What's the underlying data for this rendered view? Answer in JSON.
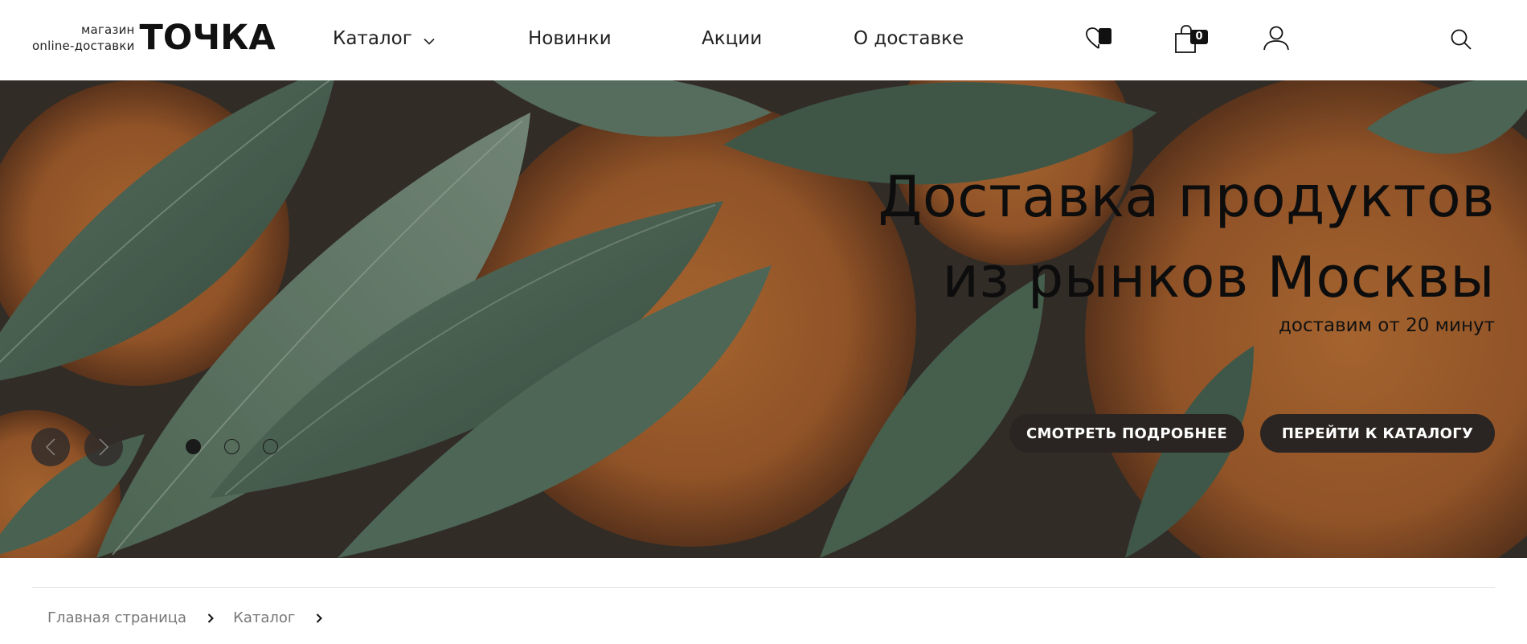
{
  "logo": {
    "line1": "магазин",
    "line2": "online-доставки",
    "brand": "ТОЧКА"
  },
  "nav": {
    "catalog": "Каталог",
    "new": "Новинки",
    "sale": "Акции",
    "delivery": "О доставке"
  },
  "header_icons": {
    "favorites": "heart-icon",
    "cart": "shopping-bag-icon",
    "cart_count": "0",
    "account": "user-icon",
    "search": "search-icon"
  },
  "hero": {
    "title_line1": "Доставка продуктов",
    "title_line2": "из рынков Москвы",
    "subtitle": "доставим от 20 минут",
    "button_more": "СМОТРЕТЬ ПОДРОБНЕЕ",
    "button_catalog": "ПЕРЕЙТИ К КАТАЛОГУ",
    "slides_total": 3,
    "active_slide": 1
  },
  "breadcrumb": {
    "items": [
      "Главная страница",
      "Каталог"
    ]
  },
  "colors": {
    "button_bg": "#2a2522",
    "text": "#1a1a1a",
    "divider": "#e3e3e3"
  }
}
